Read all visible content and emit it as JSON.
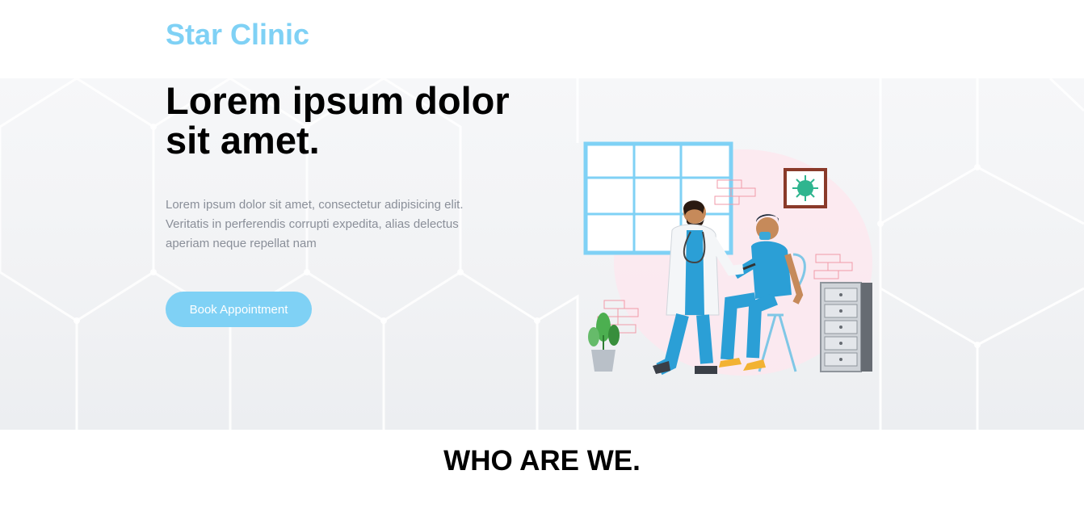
{
  "header": {
    "brand": "Star Clinic"
  },
  "hero": {
    "title": "Lorem ipsum dolor sit amet.",
    "description": "Lorem ipsum dolor sit amet, consectetur adipisicing elit. Veritatis in perferendis corrupti expedita, alias delectus aperiam neque repellat nam",
    "cta_label": "Book Appointment"
  },
  "section": {
    "title": "WHO ARE WE."
  },
  "colors": {
    "accent": "#7fd1f5",
    "heading": "#000000",
    "body_text": "#8a8f99"
  }
}
